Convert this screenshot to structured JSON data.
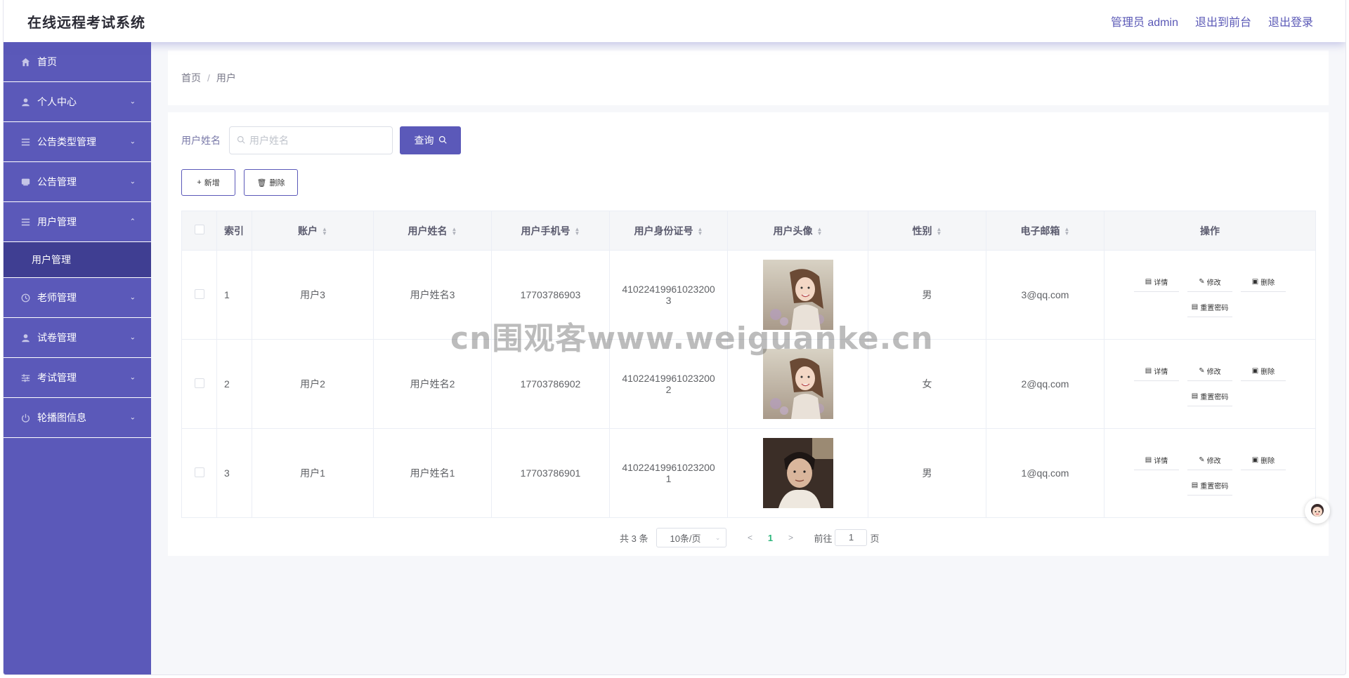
{
  "header": {
    "title": "在线远程考试系统",
    "admin_label": "管理员 admin",
    "to_front": "退出到前台",
    "logout": "退出登录"
  },
  "sidebar": {
    "items": [
      {
        "label": "首页",
        "icon": "home-icon",
        "expandable": false
      },
      {
        "label": "个人中心",
        "icon": "user-icon",
        "expandable": true,
        "expanded": false
      },
      {
        "label": "公告类型管理",
        "icon": "list-icon",
        "expandable": true,
        "expanded": false
      },
      {
        "label": "公告管理",
        "icon": "chat-icon",
        "expandable": true,
        "expanded": false
      },
      {
        "label": "用户管理",
        "icon": "list-icon",
        "expandable": true,
        "expanded": true
      },
      {
        "label": "老师管理",
        "icon": "clock-icon",
        "expandable": true,
        "expanded": false
      },
      {
        "label": "试卷管理",
        "icon": "user-icon",
        "expandable": true,
        "expanded": false
      },
      {
        "label": "考试管理",
        "icon": "sliders-icon",
        "expandable": true,
        "expanded": false
      },
      {
        "label": "轮播图信息",
        "icon": "power-icon",
        "expandable": true,
        "expanded": false
      }
    ],
    "sub_item": "用户管理"
  },
  "breadcrumb": {
    "home": "首页",
    "sep": "/",
    "current": "用户"
  },
  "search": {
    "label": "用户姓名",
    "placeholder": "用户姓名",
    "query_button": "查询"
  },
  "actions": {
    "add": "新增",
    "delete": "删除"
  },
  "table": {
    "columns": [
      "索引",
      "账户",
      "用户姓名",
      "用户手机号",
      "用户身份证号",
      "用户头像",
      "性别",
      "电子邮箱",
      "操作"
    ],
    "rows": [
      {
        "index": "1",
        "account": "用户3",
        "name": "用户姓名3",
        "phone": "17703786903",
        "id_line1": "41022419961023200",
        "id_line2": "3",
        "avatar": "girl-photo",
        "gender": "男",
        "email": "3@qq.com"
      },
      {
        "index": "2",
        "account": "用户2",
        "name": "用户姓名2",
        "phone": "17703786902",
        "id_line1": "41022419961023200",
        "id_line2": "2",
        "avatar": "girl-photo",
        "gender": "女",
        "email": "2@qq.com"
      },
      {
        "index": "3",
        "account": "用户1",
        "name": "用户姓名1",
        "phone": "17703786901",
        "id_line1": "41022419961023200",
        "id_line2": "1",
        "avatar": "boy-photo",
        "gender": "男",
        "email": "1@qq.com"
      }
    ],
    "ops": {
      "detail": "详情",
      "edit": "修改",
      "delete": "删除",
      "reset_pwd": "重置密码"
    }
  },
  "pagination": {
    "total": "共 3 条",
    "page_size": "10条/页",
    "current_page": "1",
    "goto_label": "前往",
    "goto_value": "1",
    "page_unit": "页"
  },
  "watermark": "cn围观客www.weiguanke.cn",
  "colors": {
    "accent": "#5b59b9",
    "sidebar_active_sub": "#3f3e92",
    "page_green": "#2db67c"
  }
}
